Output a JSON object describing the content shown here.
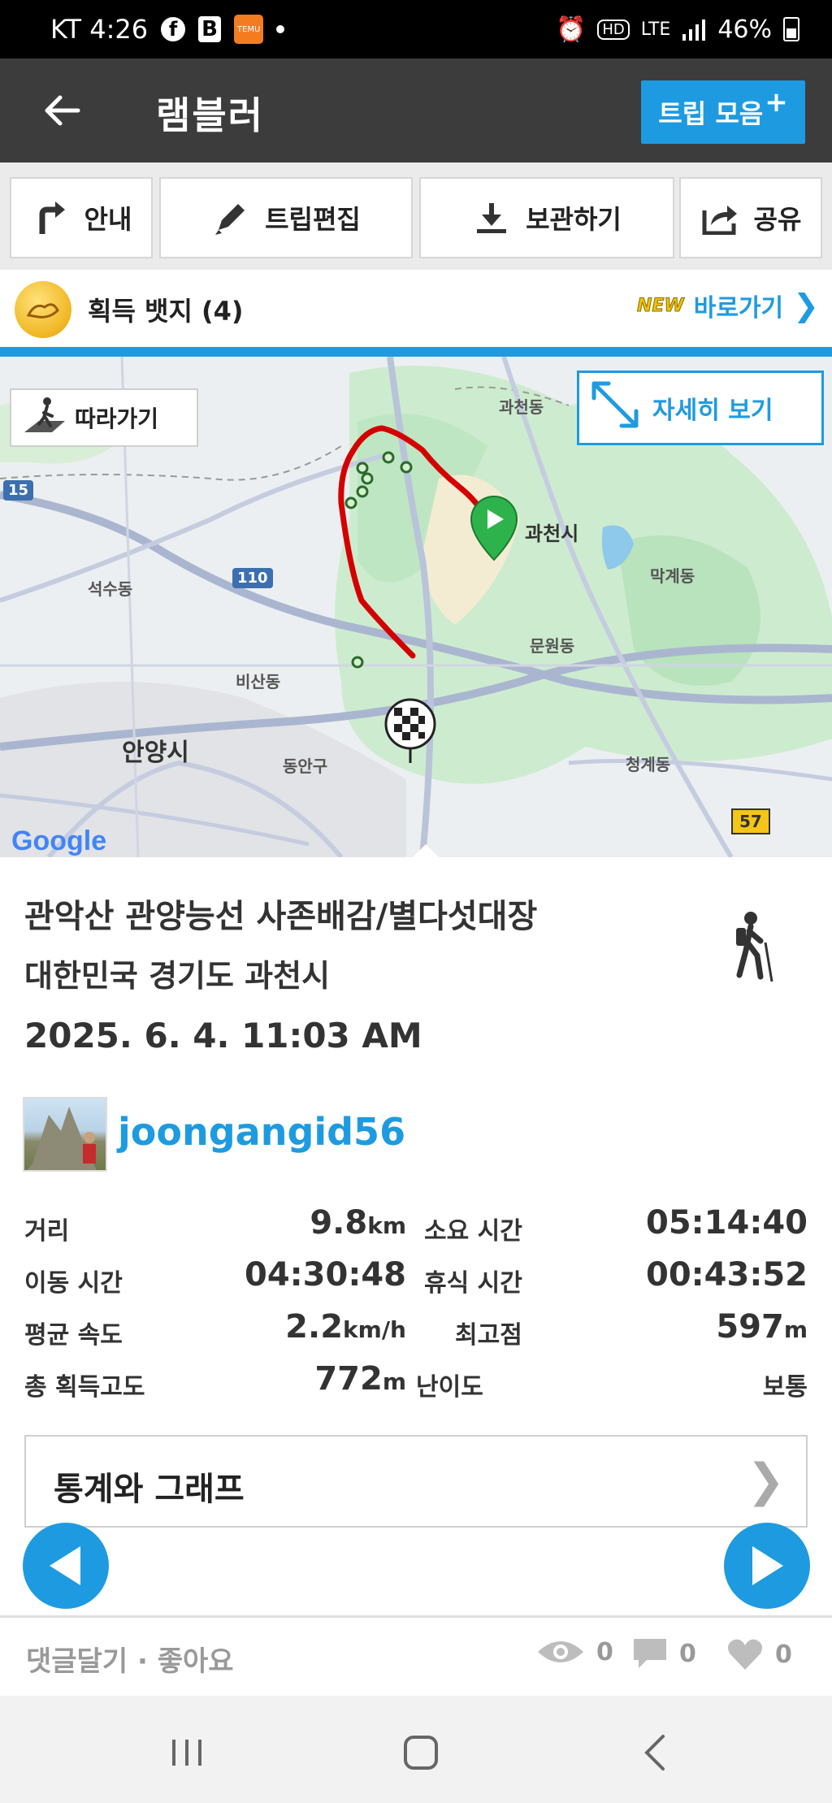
{
  "status_bar": {
    "carrier_time": "KT 4:26",
    "temu_label": "TEMU",
    "net_label": "LTE",
    "battery": "46%"
  },
  "header": {
    "title": "램블러",
    "trip_collection_label": "트립 모음",
    "trip_collection_plus": "+"
  },
  "toolbar": {
    "guide_label": "안내",
    "edit_label": "트립편집",
    "save_label": "보관하기",
    "share_label": "공유"
  },
  "badges": {
    "label": "획득 뱃지 (4)",
    "new_tag": "NEW",
    "go_label": "바로가기"
  },
  "map": {
    "follow_label": "따라가기",
    "detail_label": "자세히 보기",
    "place_labels": [
      "과천동",
      "과천시",
      "막계동",
      "석수동",
      "문원동",
      "비산동",
      "안양시",
      "동안구",
      "청계동"
    ],
    "route_shields": [
      "15",
      "110",
      "57"
    ],
    "google_logo": "Google",
    "track_color": "#d40000",
    "start_marker_color": "#2eb24b"
  },
  "trip": {
    "title": "관악산 관양능선 사존배감/별다섯대장",
    "location": "대한민국 경기도 과천시",
    "date": "2025. 6. 4. 11:03 AM",
    "username": "joongangid56"
  },
  "stats": {
    "distance_label": "거리",
    "distance_value": "9.8",
    "distance_unit": "km",
    "duration_label": "소요 시간",
    "duration_value": "05:14:40",
    "moving_label": "이동 시간",
    "moving_value": "04:30:48",
    "rest_label": "휴식 시간",
    "rest_value": "00:43:52",
    "avg_speed_label": "평균 속도",
    "avg_speed_value": "2.2",
    "avg_speed_unit": "km/h",
    "max_alt_label": "최고점",
    "max_alt_value": "597",
    "max_alt_unit": "m",
    "ascent_label": "총 획득고도",
    "ascent_value": "772",
    "ascent_unit": "m",
    "difficulty_label": "난이도",
    "difficulty_value": "보통"
  },
  "stats_graph": {
    "label": "통계와 그래프"
  },
  "footer": {
    "comment_like_label": "댓글달기 · 좋아요",
    "views": "0",
    "comments": "0",
    "likes": "0"
  },
  "colors": {
    "accent": "#1e9be0",
    "app_bar": "#3c3c3c"
  }
}
